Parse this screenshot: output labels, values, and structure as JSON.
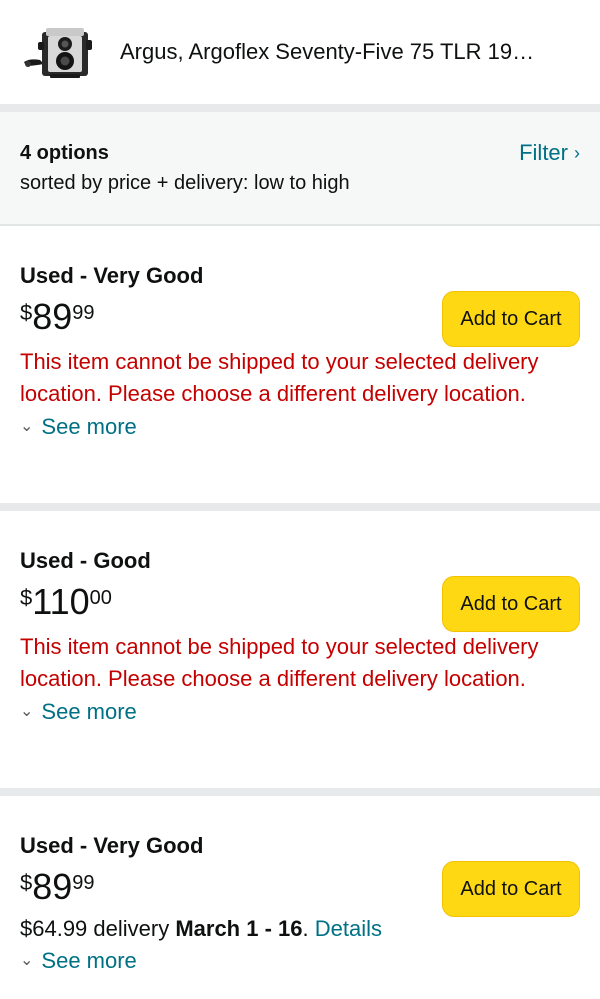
{
  "product": {
    "title": "Argus, Argoflex Seventy-Five 75 TLR 19…",
    "thumbnail_icon": "camera-thumbnail"
  },
  "summary": {
    "count": "4 options",
    "sort": "sorted by price + delivery: low to high",
    "filter_label": "Filter",
    "filter_chevron": "›"
  },
  "offers": [
    {
      "condition": "Used - Very Good",
      "price_symbol": "$",
      "price_whole": "89",
      "price_fraction": "99",
      "cart_label": "Add to Cart",
      "message": "This item cannot be shipped to your selected delivery location. Please choose a different delivery location.",
      "see_more": "See more"
    },
    {
      "condition": "Used - Good",
      "price_symbol": "$",
      "price_whole": "110",
      "price_fraction": "00",
      "cart_label": "Add to Cart",
      "message": "This item cannot be shipped to your selected delivery location. Please choose a different delivery location.",
      "see_more": "See more"
    },
    {
      "condition": "Used - Very Good",
      "price_symbol": "$",
      "price_whole": "89",
      "price_fraction": "99",
      "cart_label": "Add to Cart",
      "delivery_cost": "$64.99 delivery ",
      "delivery_date": "March 1 - 16",
      "delivery_period": ". ",
      "details_link": "Details",
      "see_more": "See more"
    }
  ],
  "chevron_down": "⌄",
  "colors": {
    "link": "#007185",
    "warning": "#c40000",
    "cart_button": "#ffd814",
    "summary_bg": "#f6f7f7"
  }
}
